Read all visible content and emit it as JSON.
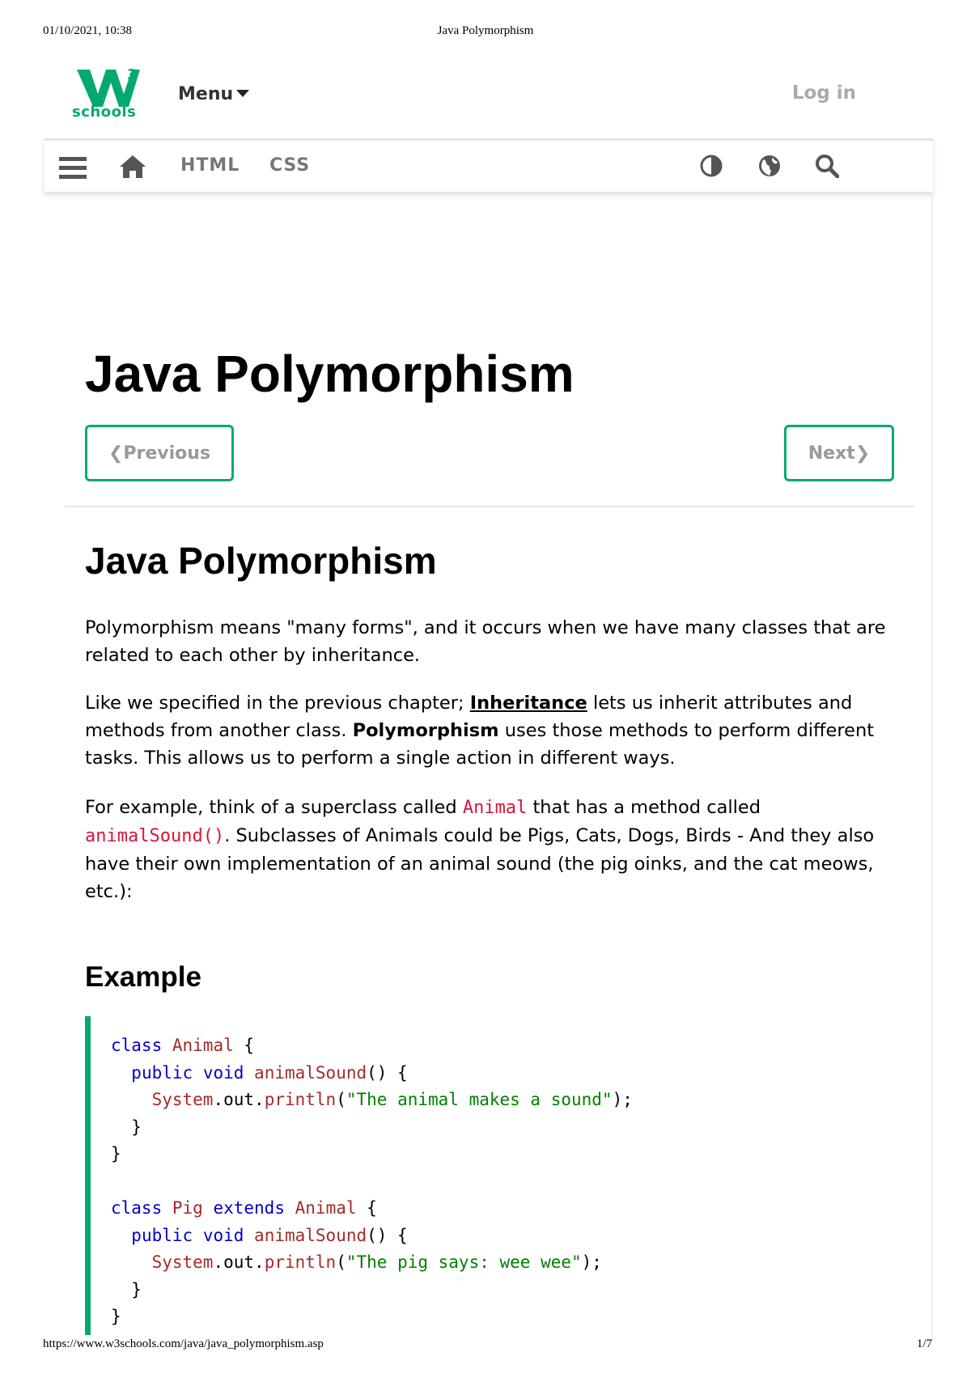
{
  "print_header": {
    "datetime": "01/10/2021, 10:38",
    "title": "Java Polymorphism"
  },
  "brand": {
    "logo_text": "schools",
    "logo_sup": "3",
    "accent": "#04AA6D"
  },
  "topbar": {
    "menu_label": "Menu",
    "login_label": "Log in"
  },
  "navbar": {
    "links": [
      {
        "label": "HTML"
      },
      {
        "label": "CSS"
      }
    ],
    "icons": [
      "hamburger-icon",
      "home-icon",
      "contrast-icon",
      "globe-icon",
      "search-icon"
    ]
  },
  "page": {
    "title": "Java Polymorphism",
    "prev_label": "Previous",
    "next_label": "Next",
    "section_title": "Java Polymorphism",
    "p1": "Polymorphism means \"many forms\", and it occurs when we have many classes that are related to each other by inheritance.",
    "p2_pre": "Like we specified in the previous chapter; ",
    "p2_link": "Inheritance",
    "p2_mid": " lets us inherit attributes and methods from another class. ",
    "p2_bold": "Polymorphism",
    "p2_post": " uses those methods to perform different tasks. This allows us to perform a single action in different ways.",
    "p3_pre": "For example, think of a superclass called ",
    "p3_code1": "Animal",
    "p3_mid": " that has a method called ",
    "p3_code2": "animalSound()",
    "p3_post": ". Subclasses of Animals could be Pigs, Cats, Dogs, Birds - And they also have their own implementation of an animal sound (the pig oinks, and the cat meows, etc.):",
    "example_title": "Example"
  },
  "code": {
    "kw_class": "class",
    "kw_public": "public",
    "kw_void": "void",
    "kw_extends": "extends",
    "cls_animal": "Animal",
    "cls_pig": "Pig",
    "method": "animalSound",
    "sys": "System",
    "out": "out",
    "println": "println",
    "str1": "\"The animal makes a sound\"",
    "str2": "\"The pig says: wee wee\""
  },
  "print_footer": {
    "url": "https://www.w3schools.com/java/java_polymorphism.asp",
    "page": "1/7"
  }
}
